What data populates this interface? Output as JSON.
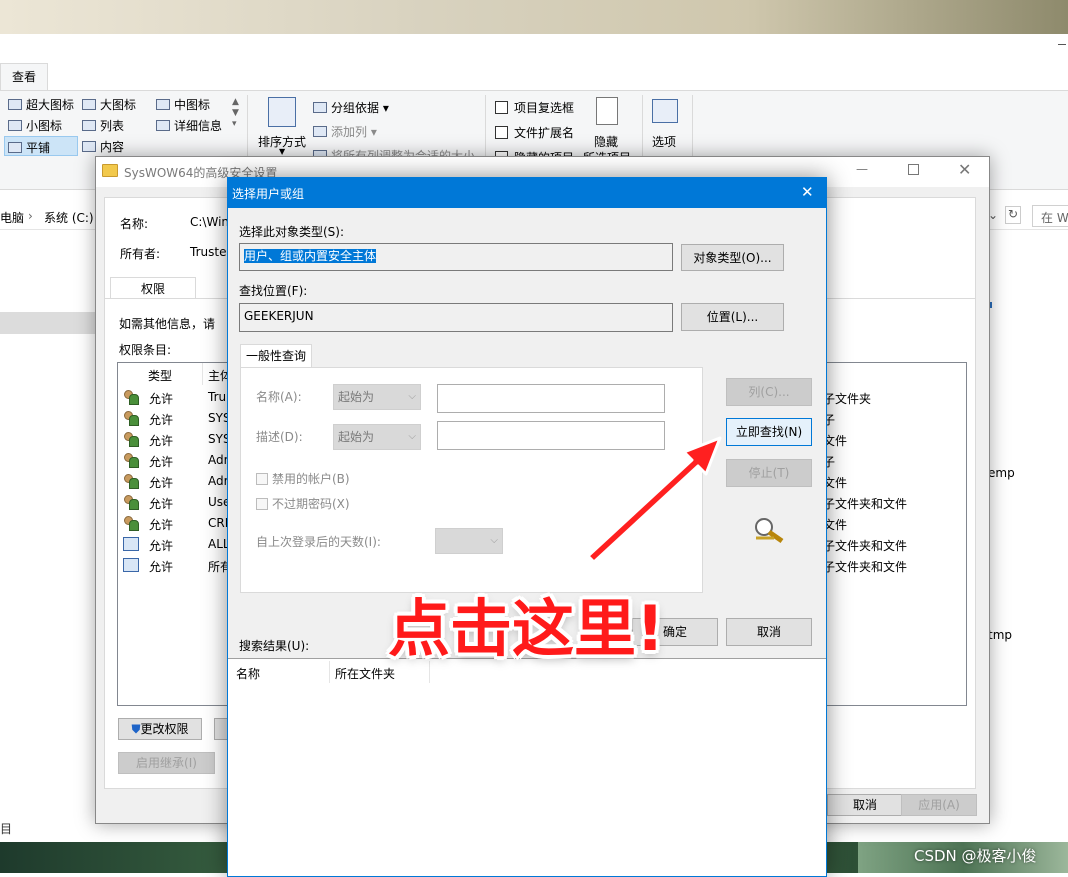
{
  "explorer": {
    "tab_view": "查看",
    "layout": {
      "extra_large": "超大图标",
      "large": "大图标",
      "medium": "中图标",
      "small": "小图标",
      "list": "列表",
      "details": "详细信息",
      "tiles": "平铺",
      "content": "内容"
    },
    "sort_by": "排序方式",
    "group_by": "分组依据",
    "add_columns": "添加列",
    "size_columns": "将所有列调整为合适的大小",
    "item_checkboxes": "项目复选框",
    "file_extensions": "文件扩展名",
    "hidden_items": "隐藏的项目",
    "hide_selected": "隐藏",
    "hide_selected_2": "所选项目",
    "options": "选项",
    "breadcrumb_pc": "电脑",
    "breadcrumb_c": "系统 (C:)",
    "search_placeholder": "在 W",
    "right_frag": [
      "emp",
      "tmp"
    ]
  },
  "security": {
    "title": "SysWOW64的高级安全设置",
    "name_label": "名称:",
    "name_value": "C:\\Win",
    "owner_label": "所有者:",
    "owner_value": "Truste",
    "tab_permissions": "权限",
    "info_text": "如需其他信息，请",
    "entries_label": "权限条目:",
    "col_type": "类型",
    "col_principal": "主体",
    "rows": [
      {
        "type": "允许",
        "principal": "Tru",
        "applies": "子文件夹"
      },
      {
        "type": "允许",
        "principal": "SYS",
        "applies": "子"
      },
      {
        "type": "允许",
        "principal": "SYS",
        "applies": "文件"
      },
      {
        "type": "允许",
        "principal": "Adr",
        "applies": "子"
      },
      {
        "type": "允许",
        "principal": "Adr",
        "applies": "文件"
      },
      {
        "type": "允许",
        "principal": "Use",
        "applies": "子文件夹和文件"
      },
      {
        "type": "允许",
        "principal": "CRI",
        "applies": "文件"
      },
      {
        "type": "允许",
        "principal": "ALL",
        "applies": "子文件夹和文件"
      },
      {
        "type": "允许",
        "principal": "所有",
        "applies": "子文件夹和文件"
      }
    ],
    "change_perm": "更改权限",
    "enable_inherit": "启用继承(I)",
    "cancel": "取消",
    "apply": "应用(A)"
  },
  "select": {
    "title": "选择用户或组",
    "obj_type_label": "选择此对象类型(S):",
    "obj_type_value": "用户、组或内置安全主体",
    "obj_type_btn": "对象类型(O)...",
    "location_label": "查找位置(F):",
    "location_value": "GEEKERJUN",
    "location_btn": "位置(L)...",
    "tab_common": "一般性查询",
    "name_label": "名称(A):",
    "desc_label": "描述(D):",
    "starts_with": "起始为",
    "disabled_acct": "禁用的帐户(B)",
    "no_expire": "不过期密码(X)",
    "days_label": "自上次登录后的天数(I):",
    "columns_btn": "列(C)...",
    "find_now_btn": "立即查找(N)",
    "stop_btn": "停止(T)",
    "ok_btn": "确定",
    "cancel_btn": "取消",
    "results_label": "搜索结果(U):",
    "res_col_name": "名称",
    "res_col_folder": "所在文件夹"
  },
  "annotation": "点击这里!",
  "watermark": "CSDN @极客小俊"
}
